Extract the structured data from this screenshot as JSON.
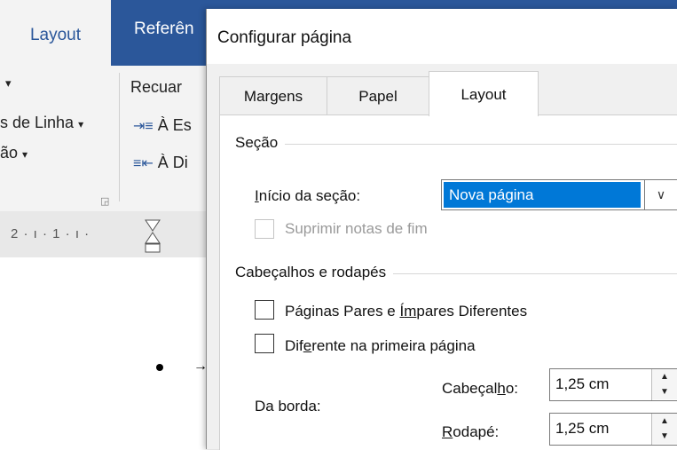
{
  "ribbon": {
    "tabs": [
      "Layout",
      "Referên"
    ],
    "text": {
      "recuar": "Recuar",
      "numeros_linha": "s de Linha",
      "hifenizacao": "ão",
      "a_esquerda": "À Es",
      "a_direita": "À Di",
      "ruler_numbers": "2 · ı · 1 · ı ·"
    }
  },
  "dialog": {
    "title": "Configurar página",
    "tabs": [
      "Margens",
      "Papel",
      "Layout"
    ],
    "active_tab": "Layout",
    "sections": {
      "secao": {
        "heading": "Seção",
        "inicio_label_pre": "I",
        "inicio_label_rest": "nício da seção:",
        "inicio_value": "Nova página",
        "suprimir_label": "Suprimir notas de fim",
        "suprimir_checked": false
      },
      "cabecalhos": {
        "heading": "Cabeçalhos e rodapés",
        "pares_pre": "Páginas Pares e ",
        "pares_u": "Í",
        "pares_mid": "m",
        "pares_post": "pares Diferentes",
        "pares_checked": false,
        "primeira_pre": "Dif",
        "primeira_u": "e",
        "primeira_post": "rente na primeira página",
        "primeira_checked": false,
        "da_borda_label": "Da borda:",
        "cabecalho_pre": "Cabeçal",
        "cabecalho_u": "h",
        "cabecalho_post": "o:",
        "cabecalho_value": "1,25 cm",
        "rodape_u": "R",
        "rodape_post": "odapé:",
        "rodape_value": "1,25 cm"
      }
    }
  }
}
